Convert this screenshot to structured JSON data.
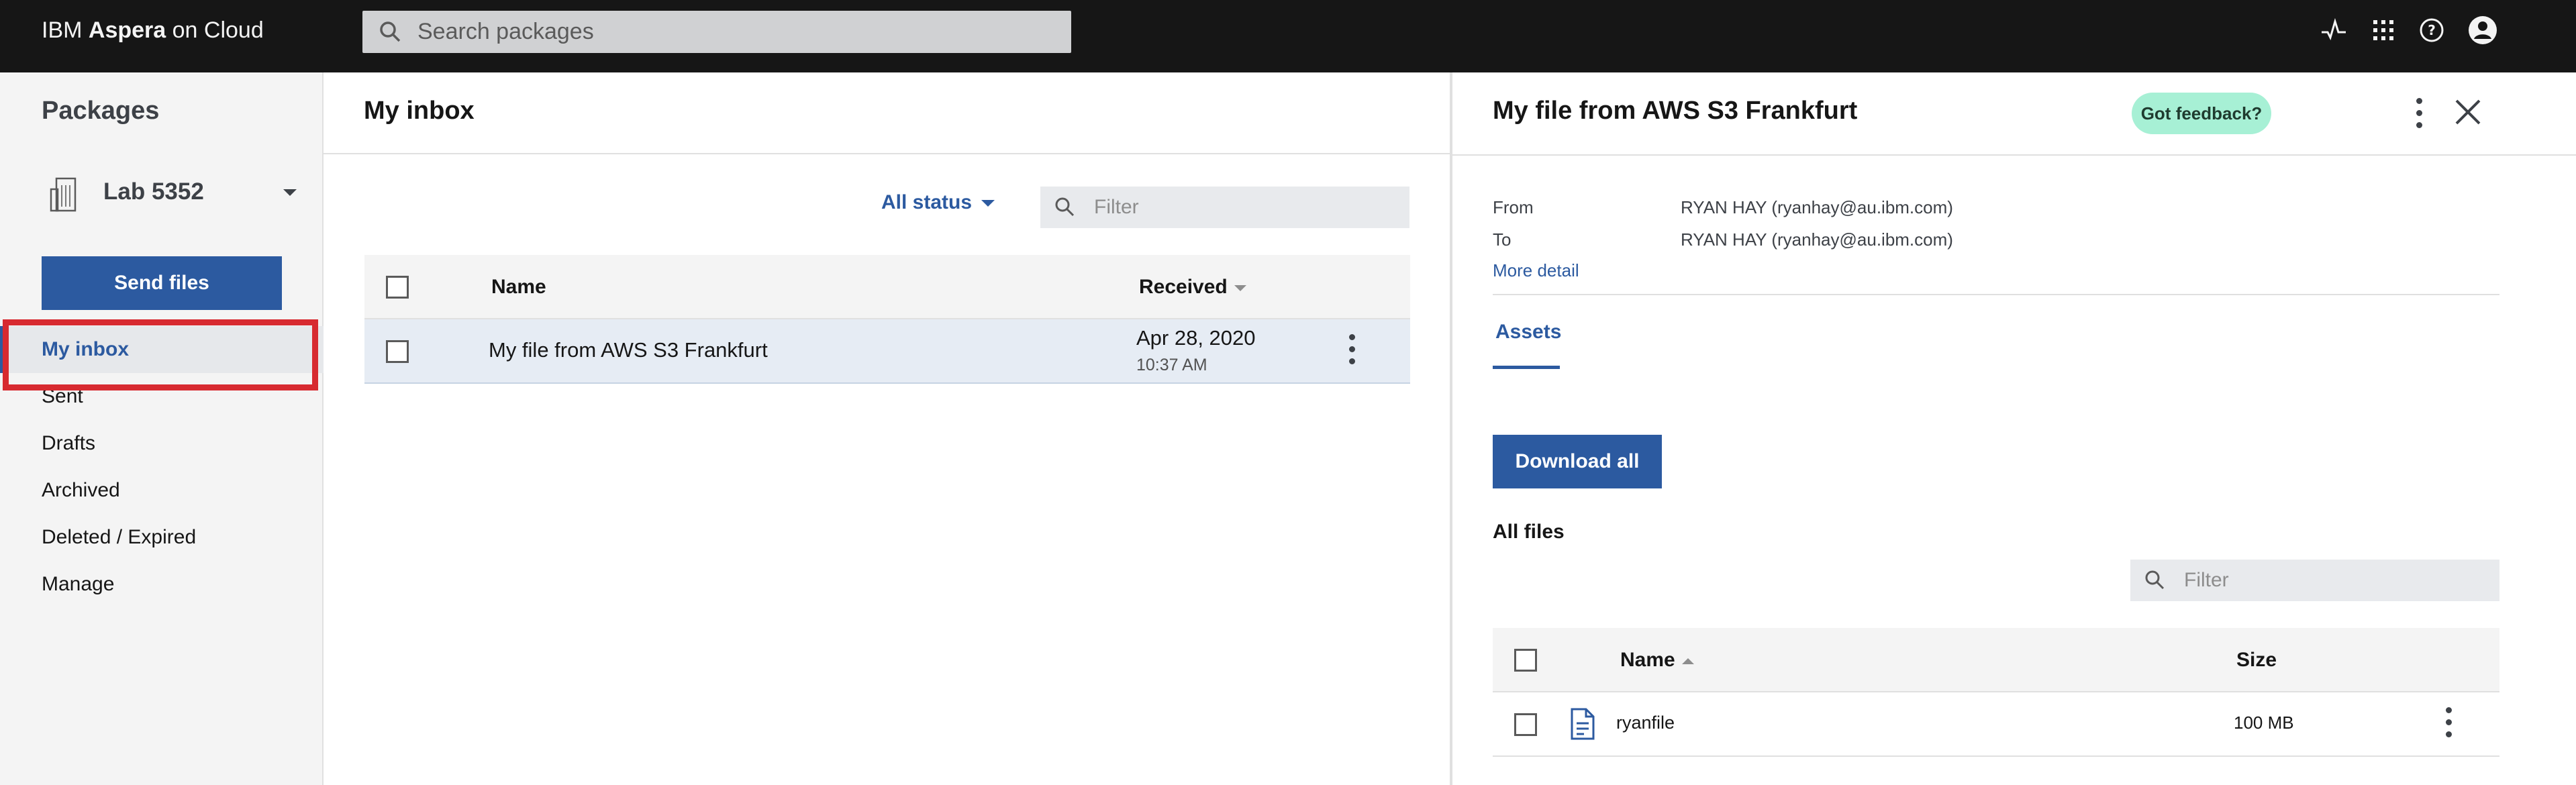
{
  "topbar": {
    "brand_prefix": "IBM ",
    "brand_bold": "Aspera",
    "brand_suffix": " on Cloud",
    "search_placeholder": "Search packages",
    "icons": [
      "activity-icon",
      "app-switcher-icon",
      "help-icon",
      "user-avatar-icon"
    ]
  },
  "sidebar": {
    "title": "Packages",
    "workspace": "Lab 5352",
    "send_label": "Send files",
    "items": [
      {
        "label": "My inbox",
        "active": true
      },
      {
        "label": "Sent"
      },
      {
        "label": "Drafts"
      },
      {
        "label": "Archived"
      },
      {
        "label": "Deleted / Expired"
      },
      {
        "label": "Manage"
      }
    ]
  },
  "inbox": {
    "title": "My inbox",
    "status_filter": "All status",
    "filter_placeholder": "Filter",
    "columns": {
      "name": "Name",
      "received": "Received"
    },
    "rows": [
      {
        "name": "My file from AWS S3 Frankfurt",
        "date": "Apr 28, 2020",
        "time": "10:37 AM"
      }
    ]
  },
  "detail": {
    "title": "My file from AWS S3 Frankfurt",
    "feedback_label": "Got feedback?",
    "from_label": "From",
    "from_value": "RYAN HAY (ryanhay@au.ibm.com)",
    "to_label": "To",
    "to_value": "RYAN HAY (ryanhay@au.ibm.com)",
    "more_detail": "More detail",
    "tab_assets": "Assets",
    "download_all": "Download all",
    "all_files": "All files",
    "filter_placeholder": "Filter",
    "columns": {
      "name": "Name",
      "size": "Size"
    },
    "files": [
      {
        "name": "ryanfile",
        "size": "100 MB"
      }
    ]
  },
  "colors": {
    "accent": "#2c5aa0",
    "topbar": "#161616",
    "highlight": "#d72a30",
    "feedback": "#a7f0d5"
  }
}
